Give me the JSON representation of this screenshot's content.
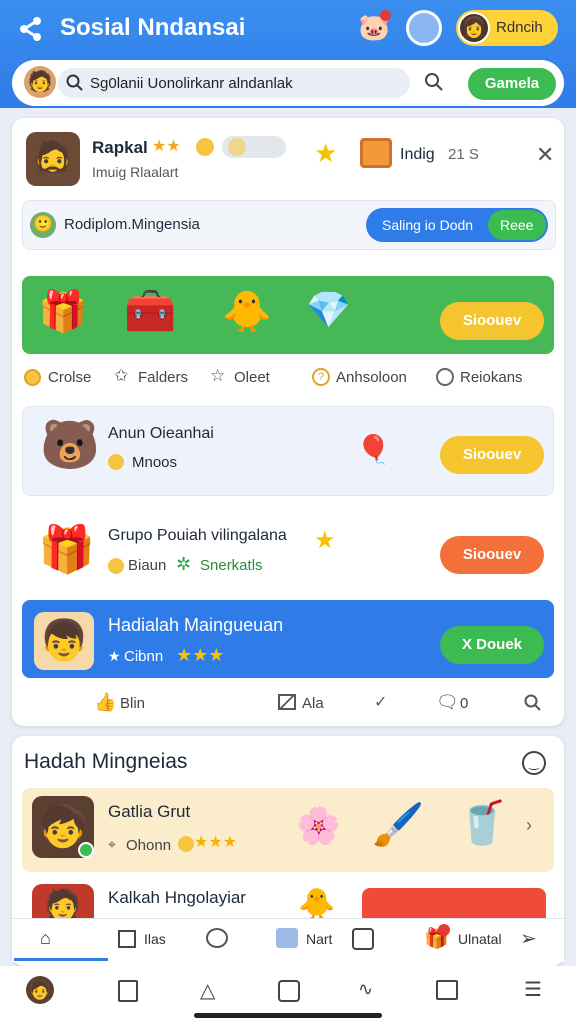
{
  "header": {
    "title": "Sosial Nndansai",
    "bell_badge": "",
    "profile_name": "Rdncih",
    "accent": "#2f7be8"
  },
  "search": {
    "value": "Sg0lanii Uonolirkanr alndanlak",
    "button_label": "Gamela"
  },
  "post": {
    "user_name": "Rapkal",
    "sub": "Imuig Rlaalart",
    "location": "Indig",
    "count": "21 S",
    "notice": "Rodiplom.Mingensia",
    "toggle_left": "Saling io Dodn",
    "toggle_right": "Reee"
  },
  "promo": {
    "button_label": "Sioouev"
  },
  "actions": [
    {
      "label": "Crolse"
    },
    {
      "label": "Falders"
    },
    {
      "label": "Oleet"
    },
    {
      "label": "Anhsoloon"
    },
    {
      "label": "Reiokans"
    }
  ],
  "rows": [
    {
      "title": "Anun Oieanhai",
      "sub": "Mnoos",
      "button": "Sioouev"
    },
    {
      "title": "Grupo Pouiah vilingalana",
      "sub1": "Biaun",
      "sub2": "Snerkatls",
      "button": "Sioouev"
    },
    {
      "title": "Hadialah Maingueuan",
      "sub": "Cibnn",
      "button": "X Douek"
    }
  ],
  "card_footer": [
    {
      "label": "Blin"
    },
    {
      "label": "Ala"
    },
    {
      "label": ""
    },
    {
      "label": "0"
    },
    {
      "label": ""
    }
  ],
  "section2": {
    "title": "Hadah Mingneias",
    "items": [
      {
        "title": "Gatlia Grut",
        "sub": "Ohonn"
      },
      {
        "title": "Kalkah Hngolayiar"
      }
    ]
  },
  "tabbar": [
    {
      "label": ""
    },
    {
      "label": "Ilas"
    },
    {
      "label": ""
    },
    {
      "label": "Nart"
    },
    {
      "label": ""
    },
    {
      "label": "Ulnatal"
    },
    {
      "label": ""
    }
  ]
}
